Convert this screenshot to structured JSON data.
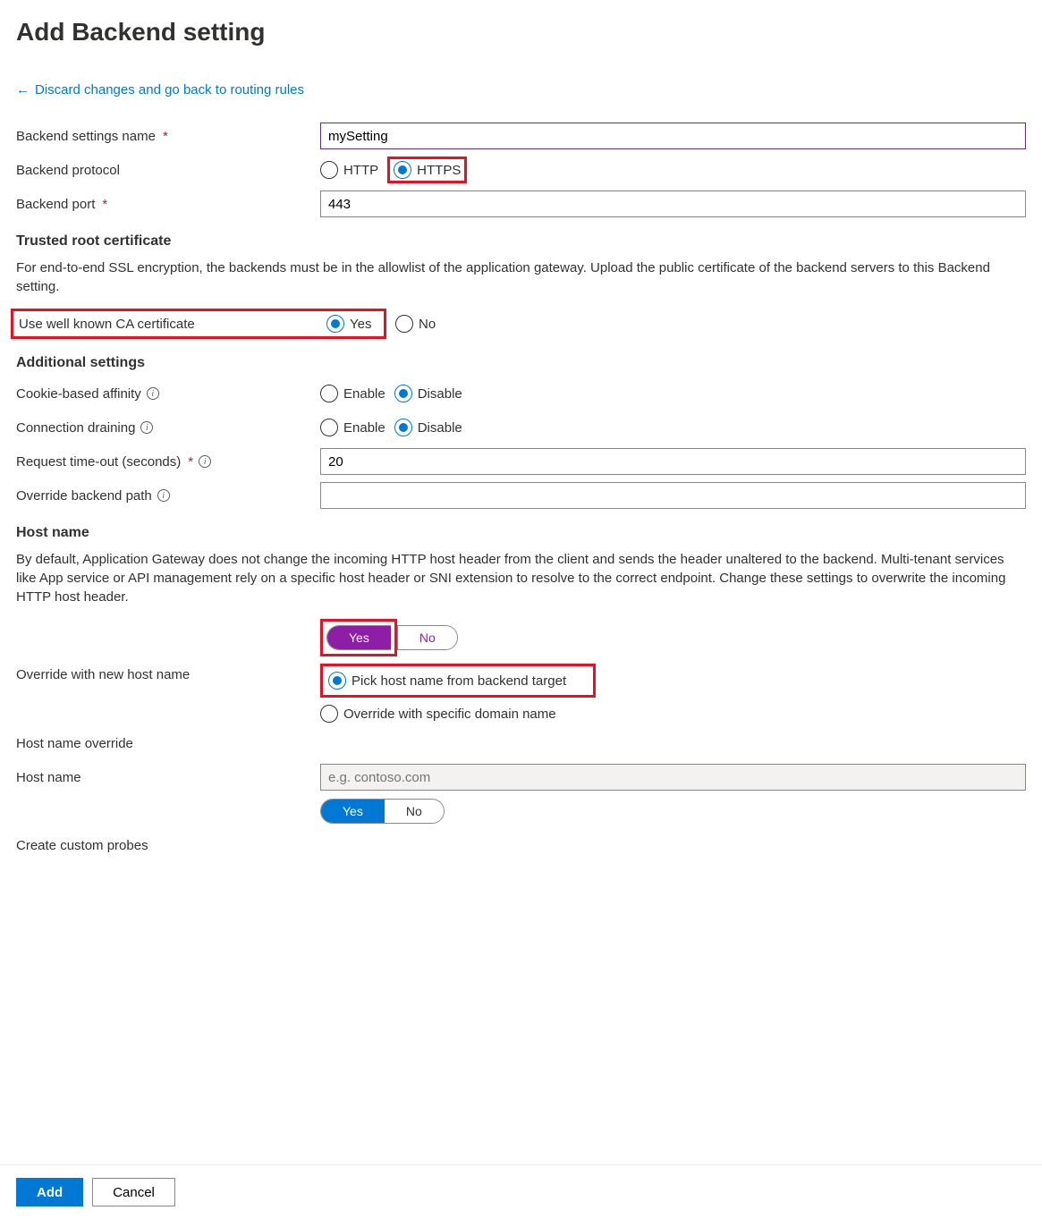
{
  "title": "Add Backend setting",
  "back_link": "Discard changes and go back to routing rules",
  "labels": {
    "settings_name": "Backend settings name",
    "protocol": "Backend protocol",
    "port": "Backend port",
    "trusted_root": "Trusted root certificate",
    "trusted_desc": "For end-to-end SSL encryption, the backends must be in the allowlist of the application gateway. Upload the public certificate of the backend servers to this Backend setting.",
    "use_ca": "Use well known CA certificate",
    "additional": "Additional settings",
    "cookie": "Cookie-based affinity",
    "drain": "Connection draining",
    "timeout": "Request time-out (seconds)",
    "override_path": "Override backend path",
    "hostname_head": "Host name",
    "hostname_desc": "By default, Application Gateway does not change the incoming HTTP host header from the client and sends the header unaltered to the backend. Multi-tenant services like App service or API management rely on a specific host header or SNI extension to resolve to the correct endpoint. Change these settings to overwrite the incoming HTTP host header.",
    "override_host": "Override with new host name",
    "pick_host": "Pick host name from backend target",
    "override_domain": "Override with specific domain name",
    "hostname_override": "Host name override",
    "hostname": "Host name",
    "custom_probes": "Create custom probes"
  },
  "values": {
    "settings_name": "mySetting",
    "port": "443",
    "timeout": "20",
    "override_path": "",
    "hostname_placeholder": "e.g. contoso.com"
  },
  "options": {
    "http": "HTTP",
    "https": "HTTPS",
    "yes": "Yes",
    "no": "No",
    "enable": "Enable",
    "disable": "Disable"
  },
  "buttons": {
    "add": "Add",
    "cancel": "Cancel"
  }
}
